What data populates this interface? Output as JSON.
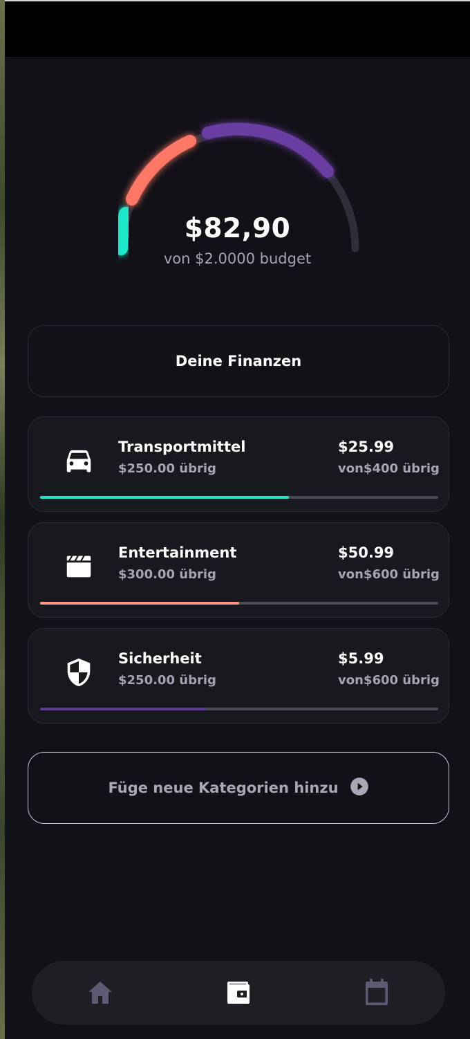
{
  "gauge": {
    "spent": "$82,90",
    "budget_text": "von $2.0000 budget",
    "segments": [
      {
        "name": "teal",
        "color": "#1de9c9"
      },
      {
        "name": "coral",
        "color": "#ff7866"
      },
      {
        "name": "purple",
        "color": "#6a3ea3"
      }
    ],
    "track_color": "#2f2e38"
  },
  "finanzen_label": "Deine Finanzen",
  "categories": [
    {
      "icon": "car-icon",
      "name": "Transportmittel",
      "remaining": "$250.00 übrig",
      "amount": "$25.99",
      "of": "von$400 übrig",
      "progress": 0.625,
      "color": "#1de9c9"
    },
    {
      "icon": "clapperboard-icon",
      "name": "Entertainment",
      "remaining": "$300.00 übrig",
      "amount": "$50.99",
      "of": "von$600 übrig",
      "progress": 0.5,
      "color": "#ff9a88"
    },
    {
      "icon": "shield-icon",
      "name": "Sicherheit",
      "remaining": "$250.00 übrig",
      "amount": "$5.99",
      "of": "von$600 übrig",
      "progress": 0.415,
      "color": "#5c3a92"
    }
  ],
  "add_button": {
    "label": "Füge neue Kategorien hinzu",
    "icon": "play-circle-icon"
  },
  "nav": {
    "items": [
      {
        "icon": "home-icon",
        "active": false
      },
      {
        "icon": "wallet-icon",
        "active": true
      },
      {
        "icon": "calendar-icon",
        "active": false
      }
    ],
    "active_color": "#ffffff",
    "inactive_color": "#5d5b73"
  }
}
